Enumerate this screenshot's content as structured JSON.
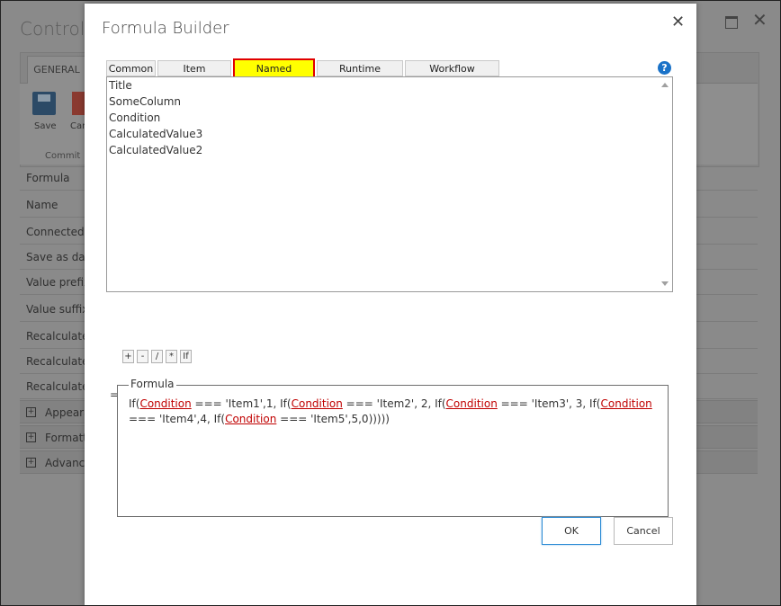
{
  "background": {
    "title": "Control S",
    "ribbon_tab": "GENERAL",
    "save_label": "Save",
    "cancel_label": "Can",
    "group_label": "Commit",
    "rows": [
      "Formula",
      "Name",
      "Connected",
      "Save as dat",
      "Value prefix",
      "Value suffix",
      "Recalculate",
      "Recalculate",
      "Recalculate"
    ],
    "expanders": [
      "Appeara",
      "Formatt",
      "Advance"
    ],
    "max_icon": "maximize-icon",
    "close_icon": "close-icon",
    "close_glyph": "✕"
  },
  "dialog": {
    "title": "Formula Builder",
    "close_glyph": "✕",
    "close_icon": "close-icon",
    "tabs": [
      {
        "label": "Common"
      },
      {
        "label": "Item Properties"
      },
      {
        "label": "Named Controls"
      },
      {
        "label": "Runtime Functions"
      },
      {
        "label": "Workflow Constants"
      }
    ],
    "active_tab": "Named Controls",
    "help_glyph": "?",
    "list_items": [
      "Title",
      "SomeColumn",
      "Condition",
      "CalculatedValue3",
      "CalculatedValue2"
    ],
    "operators": [
      "+",
      "-",
      "/",
      "*",
      "If"
    ],
    "equals": "=",
    "formula_legend": "Formula",
    "formula_parts": [
      {
        "text": "If(",
        "ctl": false
      },
      {
        "text": "Condition",
        "ctl": true
      },
      {
        "text": " === 'Item1',1, If(",
        "ctl": false
      },
      {
        "text": "Condition",
        "ctl": true
      },
      {
        "text": " === 'Item2', 2, If(",
        "ctl": false
      },
      {
        "text": "Condition",
        "ctl": true
      },
      {
        "text": " === 'Item3', 3, If(",
        "ctl": false
      },
      {
        "text": "Condition",
        "ctl": true
      },
      {
        "text": " === 'Item4',4, If(",
        "ctl": false
      },
      {
        "text": "Condition",
        "ctl": true
      },
      {
        "text": " === 'Item5',5,0)))))",
        "ctl": false
      }
    ],
    "ok_label": "OK",
    "cancel_label": "Cancel",
    "colors": {
      "active_tab_bg": "#ffff00",
      "active_tab_border": "#e00000",
      "control_ref": "#c00000",
      "help": "#1a72c8"
    }
  }
}
